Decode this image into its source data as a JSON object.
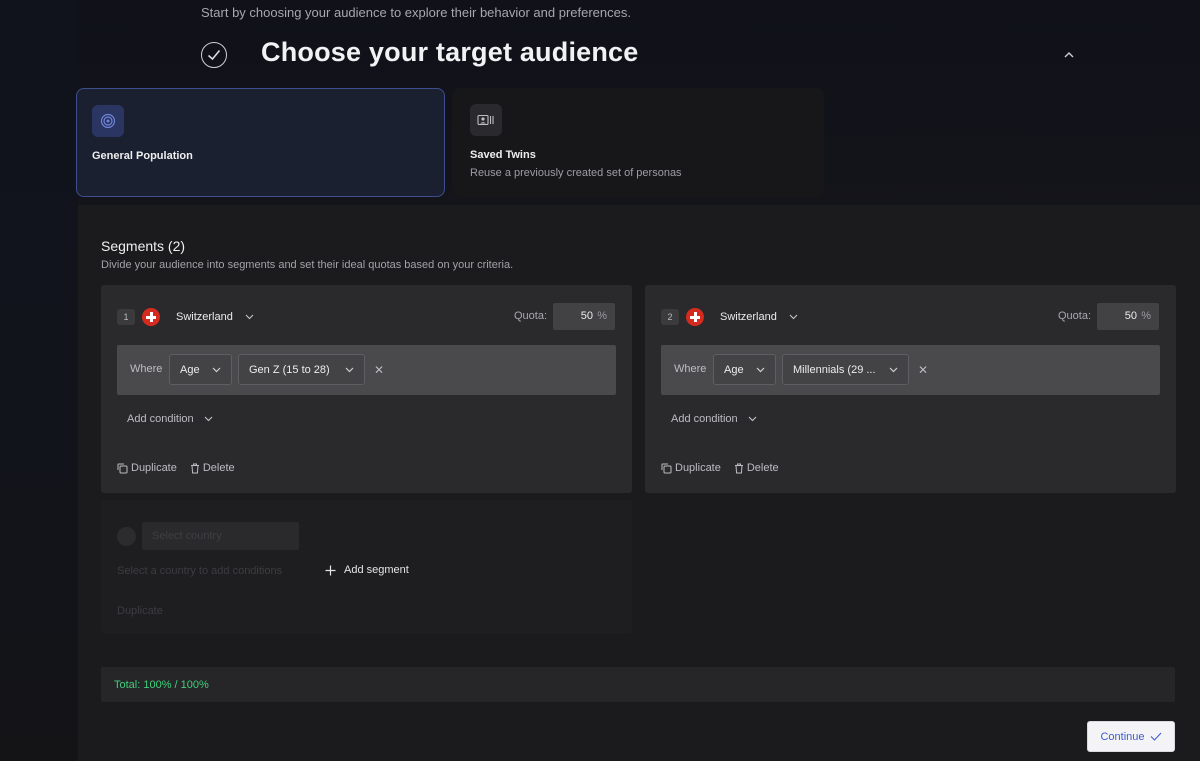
{
  "header": {
    "subtitle": "Start by choosing your audience to explore their behavior and preferences.",
    "title": "Choose your target audience"
  },
  "audience_options": [
    {
      "title": "General Population",
      "description": "",
      "icon": "target-icon",
      "selected": true
    },
    {
      "title": "Saved Twins",
      "description": "Reuse a previously created set of personas",
      "icon": "personas-icon",
      "selected": false
    }
  ],
  "segments_section": {
    "title": "Segments (2)",
    "description": "Divide your audience into segments and set their ideal quotas based on your criteria."
  },
  "segments": [
    {
      "number": "1",
      "country": "Switzerland",
      "quota_label": "Quota:",
      "quota_value": "50",
      "quota_unit": "%",
      "where_label": "Where",
      "attribute": "Age",
      "value": "Gen Z (15 to 28)",
      "add_condition": "Add condition",
      "duplicate": "Duplicate",
      "delete": "Delete"
    },
    {
      "number": "2",
      "country": "Switzerland",
      "quota_label": "Quota:",
      "quota_value": "50",
      "quota_unit": "%",
      "where_label": "Where",
      "attribute": "Age",
      "value": "Millennials (29 ...",
      "add_condition": "Add condition",
      "duplicate": "Duplicate",
      "delete": "Delete"
    }
  ],
  "new_segment": {
    "country_placeholder": "Select country",
    "hint": "Select a country to add conditions",
    "duplicate": "Duplicate",
    "add_segment": "Add segment"
  },
  "total": "Total: 100% / 100%",
  "continue_label": "Continue",
  "colors": {
    "accent": "#3e5bcc",
    "selected_border": "#3e4f8f",
    "total_ok": "#3fcf7b",
    "flag_red": "#d52b1e"
  }
}
